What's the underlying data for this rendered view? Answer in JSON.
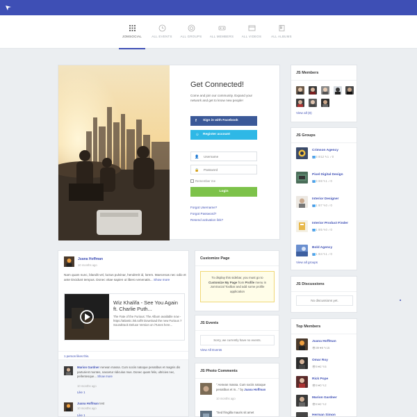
{
  "colors": {
    "topbar": "#3e4fb5",
    "link": "#3e4fb5",
    "facebook": "#3b5998",
    "register": "#2eb8e6",
    "login": "#7dc24a"
  },
  "nav": {
    "items": [
      {
        "label": "JOMSOCIAL",
        "icon": "grid-icon",
        "active": true
      },
      {
        "label": "ALL EVENTS",
        "icon": "clock-icon"
      },
      {
        "label": "ALL GROUPS",
        "icon": "circle-icon"
      },
      {
        "label": "ALL MEMBERS",
        "icon": "users-icon"
      },
      {
        "label": "ALL VIDEOS",
        "icon": "video-icon"
      },
      {
        "label": "ALL ALBUMS",
        "icon": "book-icon"
      }
    ]
  },
  "hero": {
    "title": "Get Connected!",
    "intro": "Come and join our community. Expand your network and get to know new people!",
    "facebook_button": "Sign in with Facebook",
    "register_button": "Register account",
    "username_placeholder": "Username",
    "password_placeholder": "Password",
    "remember": "Remember me",
    "login_button": "Login",
    "forgot_username": "Forgot Username?",
    "forgot_password": "Forgot Password?",
    "resend_activation": "Resend activation link?"
  },
  "members": {
    "title": "JS Members",
    "view_all": "View all (8)"
  },
  "groups": {
    "title": "JS Groups",
    "items": [
      {
        "name": "Crimson Agency",
        "stats": "👥3  ☰12  ✎1  ✓0"
      },
      {
        "name": "Pixel Digital Design",
        "stats": "👥3  ☰8  ✎1  ✓0"
      },
      {
        "name": "Interior Designer",
        "stats": "👥1  ☰7  ✎0  ✓0"
      },
      {
        "name": "Interior Product Finder",
        "stats": "👥1  ☰5  ✎0  ✓0"
      },
      {
        "name": "Bold Agency",
        "stats": "👥1  ☰4  ✎1  ✓0"
      }
    ],
    "view_all": "View all groups"
  },
  "discussions": {
    "title": "JS Discussions",
    "empty": "No discussions yet."
  },
  "top_members": {
    "title": "Top Members",
    "items": [
      {
        "name": "Juana Hoffman",
        "stats": "👁39  ♥8  ✎15"
      },
      {
        "name": "Omar Roy",
        "stats": "👁9  ♥2  ✎5"
      },
      {
        "name": "Rick Pope",
        "stats": "👁9  ♥0  ✎2"
      },
      {
        "name": "Marion Gardner",
        "stats": "👁8  ♥2  ✎2"
      },
      {
        "name": "Herman Simon",
        "stats": ""
      }
    ]
  },
  "post": {
    "author": "Juana Hoffman",
    "time": "10 months ago",
    "text": "Nam quam nunc, blandit vel, luctus pulvinar, hendrerit id, lorem. Maecenas nec odio et ante tincidunt tempus. Donec vitae sapien ut libero venenatis...",
    "more": "Show more",
    "video_title": "Wiz Khalifa - See You Again ft. Charlie Puth...",
    "video_desc": "The Fate of the Furious: The Album available now - https://atlantic.lnk.to/f8 Download the new Furious 7 Soundtrack Deluxe Version on iTunes here...",
    "likes": "1 person likes this.",
    "comments": [
      {
        "author": "Marion Gardner",
        "text": "Aenean massa. Cum sociis natoque penatibus et magnis dis parturient montes, nascetur ridiculus mus. Donec quam felis, ultricies nec, pellentesque...",
        "more": "Show more",
        "time": "10 months ago",
        "like": "Like 1"
      },
      {
        "author": "Juana Hoffman",
        "text": "test",
        "time": "10 months ago",
        "like": "Like 1"
      }
    ]
  },
  "customize": {
    "title": "Customize Page",
    "t1": "To display this sidebar, you must go to",
    "bold1": "Customize My Page",
    "t2": "from",
    "bold2": "Profile",
    "t3": "menu in JomSocial Toolbar and add some profile application"
  },
  "events": {
    "title": "JS Events",
    "empty": "Sorry, we currently have no events.",
    "view_all": "View All Events"
  },
  "photo_comments": {
    "title": "JS Photo Comments",
    "items": [
      {
        "text": "\" Aenean massa. Cum sociis natoque penatibus et m...\" by",
        "author": "Juana Hoffman",
        "time": "10 months ago"
      },
      {
        "text": "\"Sed fringilla mauris sit amet",
        "author": "",
        "time": ""
      }
    ]
  }
}
